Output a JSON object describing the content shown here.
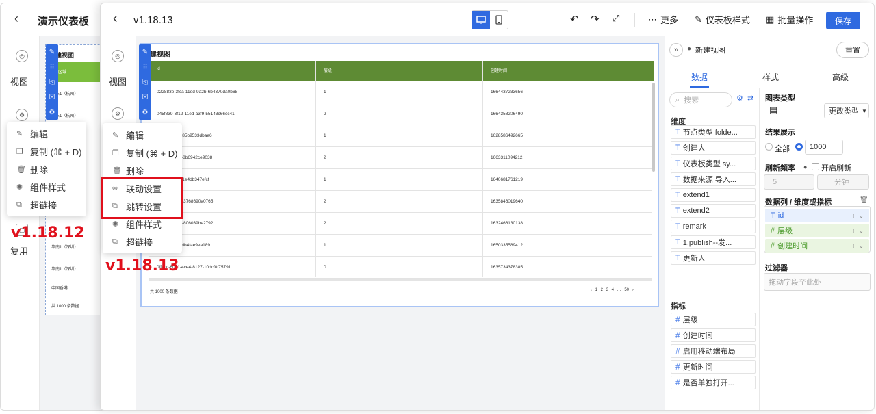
{
  "back_window": {
    "title": "演示仪表板",
    "rail": [
      {
        "label": "视图"
      },
      {
        "label": "复用"
      }
    ],
    "widget_title": "建视图",
    "rows": [
      "区域",
      "华东1（杭州）",
      "华东1（杭州）",
      "华南1（深圳）",
      "华南1（深圳）",
      "中国香港"
    ],
    "footer": "共 1000 条数据",
    "menu": [
      {
        "icon": "edit-icon",
        "label": "编辑"
      },
      {
        "icon": "copy-icon",
        "label": "复制 (⌘ + D)"
      },
      {
        "icon": "delete-icon",
        "label": "删除"
      },
      {
        "icon": "style-icon",
        "label": "组件样式"
      },
      {
        "icon": "link-icon",
        "label": "超链接"
      }
    ],
    "version_label": "v1.18.12"
  },
  "front_window": {
    "title": "v1.18.13",
    "toolbar": {
      "more": "更多",
      "dashboard_style": "仪表板样式",
      "batch": "批量操作",
      "save": "保存"
    },
    "rail": [
      {
        "label": "视图"
      }
    ],
    "menu": [
      {
        "icon": "edit-icon",
        "label": "编辑"
      },
      {
        "icon": "copy-icon",
        "label": "复制 (⌘ + D)"
      },
      {
        "icon": "delete-icon",
        "label": "删除"
      },
      {
        "icon": "linkage-icon",
        "label": "联动设置"
      },
      {
        "icon": "jump-icon",
        "label": "跳转设置"
      },
      {
        "icon": "style-icon",
        "label": "组件样式"
      },
      {
        "icon": "link-icon",
        "label": "超链接"
      }
    ],
    "version_label": "v1.18.13",
    "table": {
      "title": "建视图",
      "columns": [
        "id",
        "层级",
        "创建时间"
      ],
      "rows": [
        [
          "022883e-3fca-11ed-9a2b-6b4370da0b68",
          "1",
          "1664437233656"
        ],
        [
          "045f839-3f12-11ed-a3f9-55143c66cc41",
          "2",
          "1664358206490"
        ],
        [
          "4-4f95-a75e-85b9533dbae6",
          "1",
          "1628586492665"
        ],
        [
          "c-11ed-8232-8b6942ce9038",
          "2",
          "1663311094212"
        ],
        [
          "3-4956-b30f-1e4db347efcf",
          "1",
          "1640681761219"
        ],
        [
          "a-4939-a378-3768690a0765",
          "2",
          "1635846019640"
        ],
        [
          "7-4549-a3d4-806039be2792",
          "2",
          "1632466130138"
        ],
        [
          "9-11ec-b16f-db4fae9ea189",
          "1",
          "1650335569412"
        ],
        [
          "0ffacc-6071-4ce4-8127-10dcf0f75791",
          "0",
          "1635734378385"
        ]
      ],
      "footer": "共 1000 条数据",
      "pager": "‹ 1 2 3 4 … 50 ›"
    },
    "right_panel": {
      "title": "新建视图",
      "reset": "重置",
      "tabs": [
        "数据",
        "样式",
        "高级"
      ],
      "search_placeholder": "搜索",
      "dimensions_title": "维度",
      "dimensions": [
        "节点类型 folde...",
        "创建人",
        "仪表板类型 sy...",
        "数据来源 导入...",
        "extend1",
        "extend2",
        "remark",
        "1.publish--发...",
        "更新人"
      ],
      "metrics_title": "指标",
      "metrics": [
        "层级",
        "创建时间",
        "启用移动端布局",
        "更新时间",
        "是否单独打开..."
      ],
      "chart_type_title": "图表类型",
      "change_type": "更改类型",
      "result_title": "结果展示",
      "result_all": "全部",
      "result_limit": "1000",
      "refresh_title": "刷新频率",
      "refresh_toggle": "开启刷新",
      "refresh_value": "5",
      "refresh_unit": "分钟",
      "columns_title": "数据列 / 维度或指标",
      "columns": [
        {
          "type": "T",
          "label": "id"
        },
        {
          "type": "#",
          "label": "层级"
        },
        {
          "type": "#",
          "label": "创建时间"
        }
      ],
      "filter_title": "过滤器",
      "filter_placeholder": "拖动字段至此处"
    }
  }
}
